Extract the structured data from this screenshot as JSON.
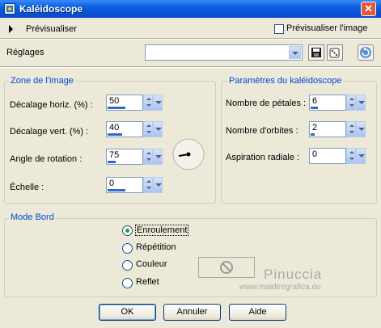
{
  "window": {
    "title": "Kaléidoscope",
    "close_glyph": "✕"
  },
  "preview": {
    "label": "Prévisualiser",
    "checkbox_label": "Prévisualiser l'image",
    "checked": false
  },
  "settings": {
    "label": "Réglages",
    "preset_value": ""
  },
  "image_zone": {
    "legend": "Zone de l'image",
    "fields": [
      {
        "label": "Décalage horiz. (%) :",
        "value": "50",
        "fill": 0.5
      },
      {
        "label": "Décalage vert. (%) :",
        "value": "40",
        "fill": 0.4
      },
      {
        "label": "Angle de rotation :",
        "value": "75",
        "fill": 0.21
      },
      {
        "label": "Échelle :",
        "value": "0",
        "fill": 0.5
      }
    ]
  },
  "kaleido_params": {
    "legend": "Paramètres du kaléidoscope",
    "fields": [
      {
        "label": "Nombre de pétales :",
        "value": "6",
        "fill": 0.2
      },
      {
        "label": "Nombre d'orbites :",
        "value": "2",
        "fill": 0.1
      },
      {
        "label": "Aspiration radiale :",
        "value": "0",
        "fill": 0.0
      }
    ]
  },
  "edge_mode": {
    "legend": "Mode Bord",
    "options": [
      "Enroulement",
      "Répétition",
      "Couleur",
      "Reflet"
    ],
    "selected": 0
  },
  "buttons": {
    "ok": "OK",
    "cancel": "Annuler",
    "help": "Aide"
  },
  "watermark": {
    "line1": "Pinuccia",
    "line2": "www.maidiregrafica.eu"
  },
  "colors": {
    "accent": "#316ac5",
    "legend": "#0046d5",
    "titlebar": "#0a5ee0",
    "selected_radio": "#21a121"
  }
}
